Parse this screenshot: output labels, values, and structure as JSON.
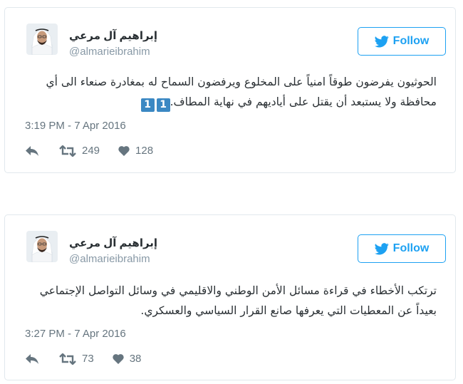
{
  "colors": {
    "accent": "#1da1f2",
    "badge": "#3b88c3",
    "muted": "#66757f",
    "border": "#e1e8ed"
  },
  "tweets": [
    {
      "author_name": "إبراهيم آل مرعي",
      "handle": "@almarieibrahim",
      "follow_label": "Follow",
      "text_line1": "الحوثيون يفرضون طوقاً امنياً على المخلوع ويرفضون السماح له بمغادرة صنعاء الى أي",
      "text_line2": "محافظة ولا يستبعد أن يقتل على أياديهم في نهاية المطاف.",
      "badges": [
        "1",
        "1"
      ],
      "timestamp": "3:19 PM - 7 Apr 2016",
      "retweets": "249",
      "likes": "128"
    },
    {
      "author_name": "إبراهيم آل مرعي",
      "handle": "@almarieibrahim",
      "follow_label": "Follow",
      "text_line1": "ترتكب الأخطاء في قراءة مسائل الأمن الوطني والاقليمي في وسائل التواصل الإجتماعي",
      "text_line2": "بعيداً عن المعطيات التي يعرفها صانع القرار السياسي والعسكري.",
      "timestamp": "3:27 PM - 7 Apr 2016",
      "retweets": "73",
      "likes": "38"
    }
  ]
}
